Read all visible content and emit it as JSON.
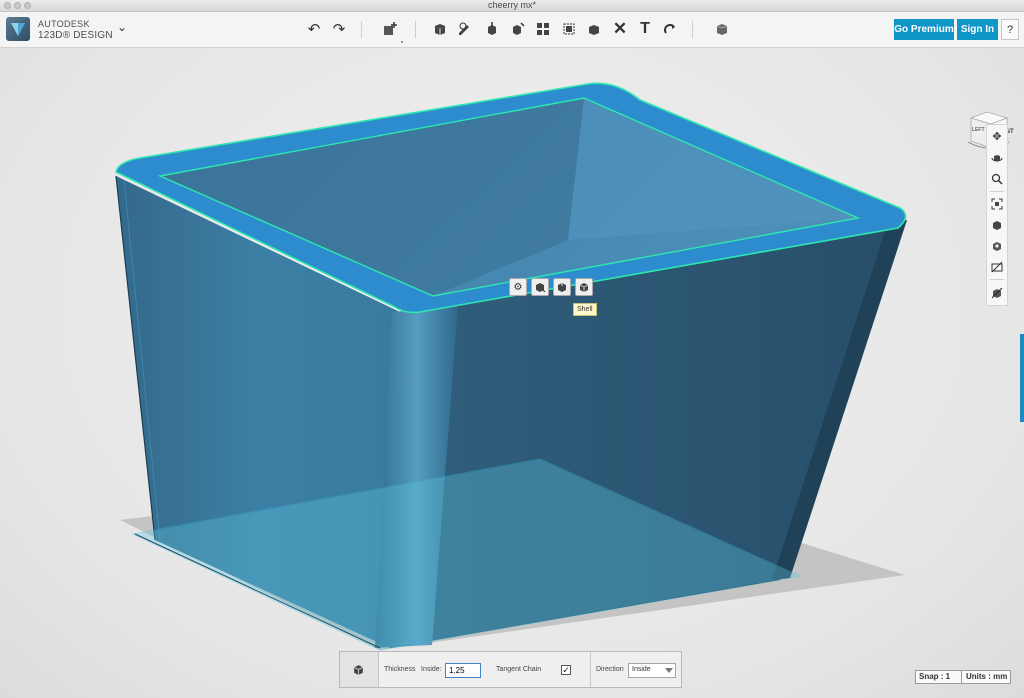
{
  "window": {
    "title": "cheerry mx*"
  },
  "app": {
    "brand_line1": "AUTODESK",
    "brand_line2": "123D® DESIGN",
    "menu_icon": "chevron-down-icon"
  },
  "toolbar": {
    "tools": [
      {
        "name": "undo-icon"
      },
      {
        "name": "redo-icon"
      },
      {
        "name": "transform-icon"
      },
      {
        "name": "primitives-icon"
      },
      {
        "name": "sketch-icon"
      },
      {
        "name": "construct-icon"
      },
      {
        "name": "modify-icon"
      },
      {
        "name": "pattern-icon"
      },
      {
        "name": "grouping-icon"
      },
      {
        "name": "combine-icon"
      },
      {
        "name": "measure-icon"
      },
      {
        "name": "text-icon"
      },
      {
        "name": "snap-icon"
      },
      {
        "name": "material-icon"
      }
    ],
    "go_premium": "Go Premium",
    "sign_in": "Sign In",
    "help": "?"
  },
  "viewcube": {
    "face_front": "FRONT",
    "face_left": "LEFT"
  },
  "nav": {
    "items": [
      {
        "name": "pan-icon"
      },
      {
        "name": "orbit-icon"
      },
      {
        "name": "zoom-icon"
      },
      {
        "name": "fit-icon"
      },
      {
        "name": "ortho-icon"
      },
      {
        "name": "visibility-icon"
      },
      {
        "name": "hide-sketch-icon"
      },
      {
        "name": "hide-mesh-icon"
      }
    ]
  },
  "marking_menu": {
    "items": [
      {
        "name": "settings-gear-icon"
      },
      {
        "name": "tweak-icon"
      },
      {
        "name": "press-pull-icon"
      },
      {
        "name": "shell-icon"
      }
    ],
    "tooltip": "Shell"
  },
  "shell_panel": {
    "thickness_label": "Thickness",
    "inside_label": "Inside:",
    "thickness_value": "1.25",
    "tangent_chain_label": "Tangent Chain",
    "tangent_chain_checked": "✓",
    "direction_label": "Direction",
    "direction_value": "Inside"
  },
  "status": {
    "snap": "Snap : 1",
    "units": "Units : mm"
  },
  "colors": {
    "accent": "#0f96c9",
    "model_body": "#3d7fa3",
    "model_top": "#2f86c0",
    "selection_edge": "#2ee6b0"
  }
}
